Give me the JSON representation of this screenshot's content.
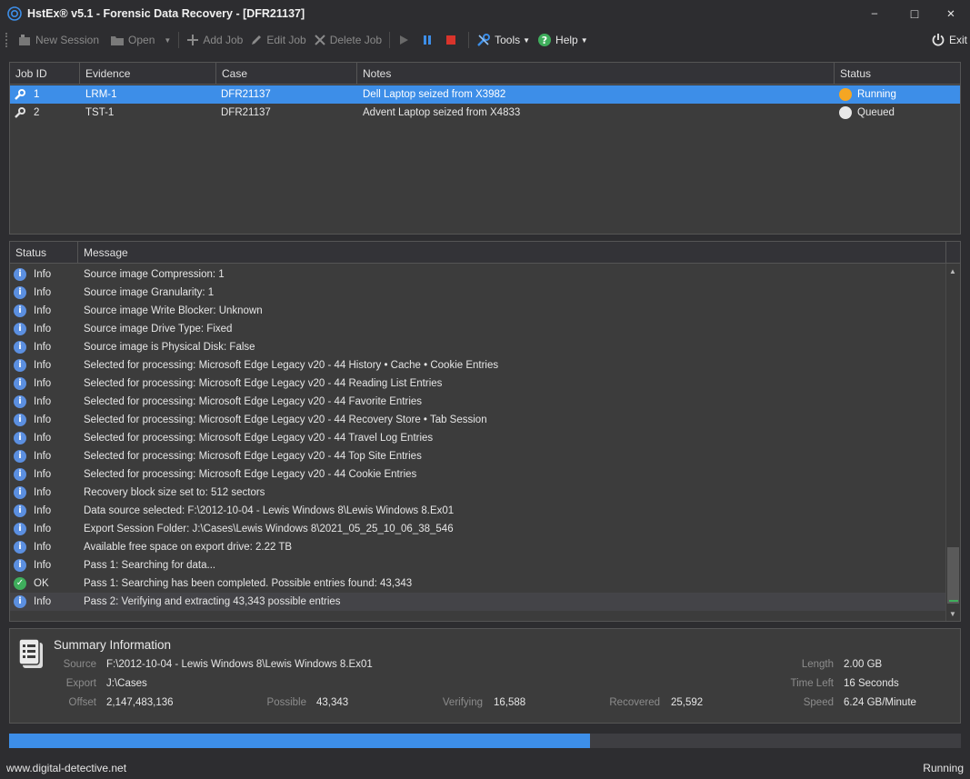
{
  "window": {
    "title": "HstEx® v5.1 - Forensic Data Recovery - [DFR21137]",
    "minimize_glyph": "–",
    "maximize_glyph": "□",
    "close_glyph": "✕"
  },
  "toolbar": {
    "new_session": "New Session",
    "open": "Open",
    "add_job": "Add Job",
    "edit_job": "Edit Job",
    "delete_job": "Delete Job",
    "tools": "Tools",
    "help": "Help",
    "exit": "Exit"
  },
  "jobs": {
    "columns": [
      "Job ID",
      "Evidence",
      "Case",
      "Notes",
      "Status"
    ],
    "rows": [
      {
        "id": "1",
        "evidence": "LRM-1",
        "case": "DFR21137",
        "notes": "Dell Laptop seized from X3982",
        "status": "Running",
        "status_color": "#f5a623",
        "selected": true
      },
      {
        "id": "2",
        "evidence": "TST-1",
        "case": "DFR21137",
        "notes": "Advent Laptop seized from X4833",
        "status": "Queued",
        "status_color": "#e8e8e8",
        "selected": false
      }
    ]
  },
  "log": {
    "columns": [
      "Status",
      "Message"
    ],
    "rows": [
      {
        "status": "Info",
        "icon": "info-icon",
        "message": "Source image Compression: 1"
      },
      {
        "status": "Info",
        "icon": "info-icon",
        "message": "Source image Granularity: 1"
      },
      {
        "status": "Info",
        "icon": "info-icon",
        "message": "Source image Write Blocker: Unknown"
      },
      {
        "status": "Info",
        "icon": "info-icon",
        "message": "Source image Drive Type: Fixed"
      },
      {
        "status": "Info",
        "icon": "info-icon",
        "message": "Source image is Physical Disk: False"
      },
      {
        "status": "Info",
        "icon": "info-icon",
        "message": "Selected for processing: Microsoft Edge Legacy v20 - 44 History • Cache • Cookie Entries"
      },
      {
        "status": "Info",
        "icon": "info-icon",
        "message": "Selected for processing: Microsoft Edge Legacy v20 - 44 Reading List Entries"
      },
      {
        "status": "Info",
        "icon": "info-icon",
        "message": "Selected for processing: Microsoft Edge Legacy v20 - 44 Favorite Entries"
      },
      {
        "status": "Info",
        "icon": "info-icon",
        "message": "Selected for processing: Microsoft Edge Legacy v20 - 44 Recovery Store • Tab Session"
      },
      {
        "status": "Info",
        "icon": "info-icon",
        "message": "Selected for processing: Microsoft Edge Legacy v20 - 44 Travel Log Entries"
      },
      {
        "status": "Info",
        "icon": "info-icon",
        "message": "Selected for processing: Microsoft Edge Legacy v20 - 44 Top Site Entries"
      },
      {
        "status": "Info",
        "icon": "info-icon",
        "message": "Selected for processing: Microsoft Edge Legacy v20 - 44 Cookie Entries"
      },
      {
        "status": "Info",
        "icon": "info-icon",
        "message": "Recovery block size set to: 512 sectors"
      },
      {
        "status": "Info",
        "icon": "info-icon",
        "message": "Data source selected: F:\\2012-10-04 - Lewis Windows 8\\Lewis Windows 8.Ex01"
      },
      {
        "status": "Info",
        "icon": "info-icon",
        "message": "Export Session Folder: J:\\Cases\\Lewis Windows 8\\2021_05_25_10_06_38_546"
      },
      {
        "status": "Info",
        "icon": "info-icon",
        "message": "Available free space on export drive: 2.22 TB"
      },
      {
        "status": "Info",
        "icon": "info-icon",
        "message": "Pass 1: Searching for data..."
      },
      {
        "status": "OK",
        "icon": "ok-icon",
        "message": "Pass 1: Searching has been completed. Possible entries found: 43,343"
      },
      {
        "status": "Info",
        "icon": "info-icon",
        "message": "Pass 2: Verifying and extracting 43,343 possible entries"
      }
    ]
  },
  "summary": {
    "title": "Summary Information",
    "source_label": "Source",
    "source": "F:\\2012-10-04 - Lewis Windows 8\\Lewis Windows 8.Ex01",
    "export_label": "Export",
    "export": "J:\\Cases",
    "offset_label": "Offset",
    "offset": "2,147,483,136",
    "possible_label": "Possible",
    "possible": "43,343",
    "verifying_label": "Verifying",
    "verifying": "16,588",
    "recovered_label": "Recovered",
    "recovered": "25,592",
    "length_label": "Length",
    "length": "2.00 GB",
    "time_left_label": "Time Left",
    "time_left": "16 Seconds",
    "speed_label": "Speed",
    "speed": "6.24 GB/Minute"
  },
  "progress": {
    "fraction": 0.61
  },
  "statusbar": {
    "website": "www.digital-detective.net",
    "state": "Running"
  }
}
